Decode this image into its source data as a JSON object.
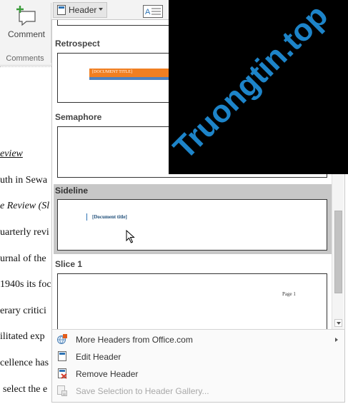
{
  "ribbon": {
    "comment_label": "Comment",
    "comments_group_label": "Comments",
    "header_button_label": "Header"
  },
  "document": {
    "lines": [
      {
        "text": "eview",
        "style": "italic underline"
      },
      {
        "text": "uth in Sewa",
        "style": ""
      },
      {
        "text": "e Review (Sl",
        "style": "italic"
      },
      {
        "text": "uarterly revi",
        "style": ""
      },
      {
        "text": "urnal of the",
        "style": ""
      },
      {
        "text": "1940s its foc",
        "style": ""
      },
      {
        "text": "erary critici",
        "style": ""
      },
      {
        "text": "ilitated exp",
        "style": ""
      },
      {
        "text": "cellence has",
        "style": ""
      },
      {
        "text": "select the e",
        "style": ""
      }
    ]
  },
  "gallery": {
    "items": [
      {
        "name": "Retrospect",
        "thumb_text": "[DOCUMENT TITLE]"
      },
      {
        "name": "Semaphore",
        "thumb_text": ""
      },
      {
        "name": "Sideline",
        "thumb_text": "[Document title]",
        "selected": true
      },
      {
        "name": "Slice 1",
        "thumb_text": "Page 1"
      }
    ]
  },
  "menu": {
    "items": [
      {
        "label": "More Headers from Office.com",
        "icon": "office-globe-icon",
        "submenu": true,
        "disabled": false
      },
      {
        "label": "Edit Header",
        "icon": "edit-header-icon",
        "submenu": false,
        "disabled": false
      },
      {
        "label": "Remove Header",
        "icon": "remove-header-icon",
        "submenu": false,
        "disabled": false
      },
      {
        "label": "Save Selection to Header Gallery...",
        "icon": "save-selection-icon",
        "submenu": false,
        "disabled": true
      }
    ]
  },
  "watermark": {
    "text": "Truongtin.top"
  },
  "colors": {
    "retrospect_orange": "#f07f22",
    "retrospect_blue": "#4f81bd",
    "selected_bg": "#c7c7c7",
    "watermark_blue": "#1d84c9"
  }
}
